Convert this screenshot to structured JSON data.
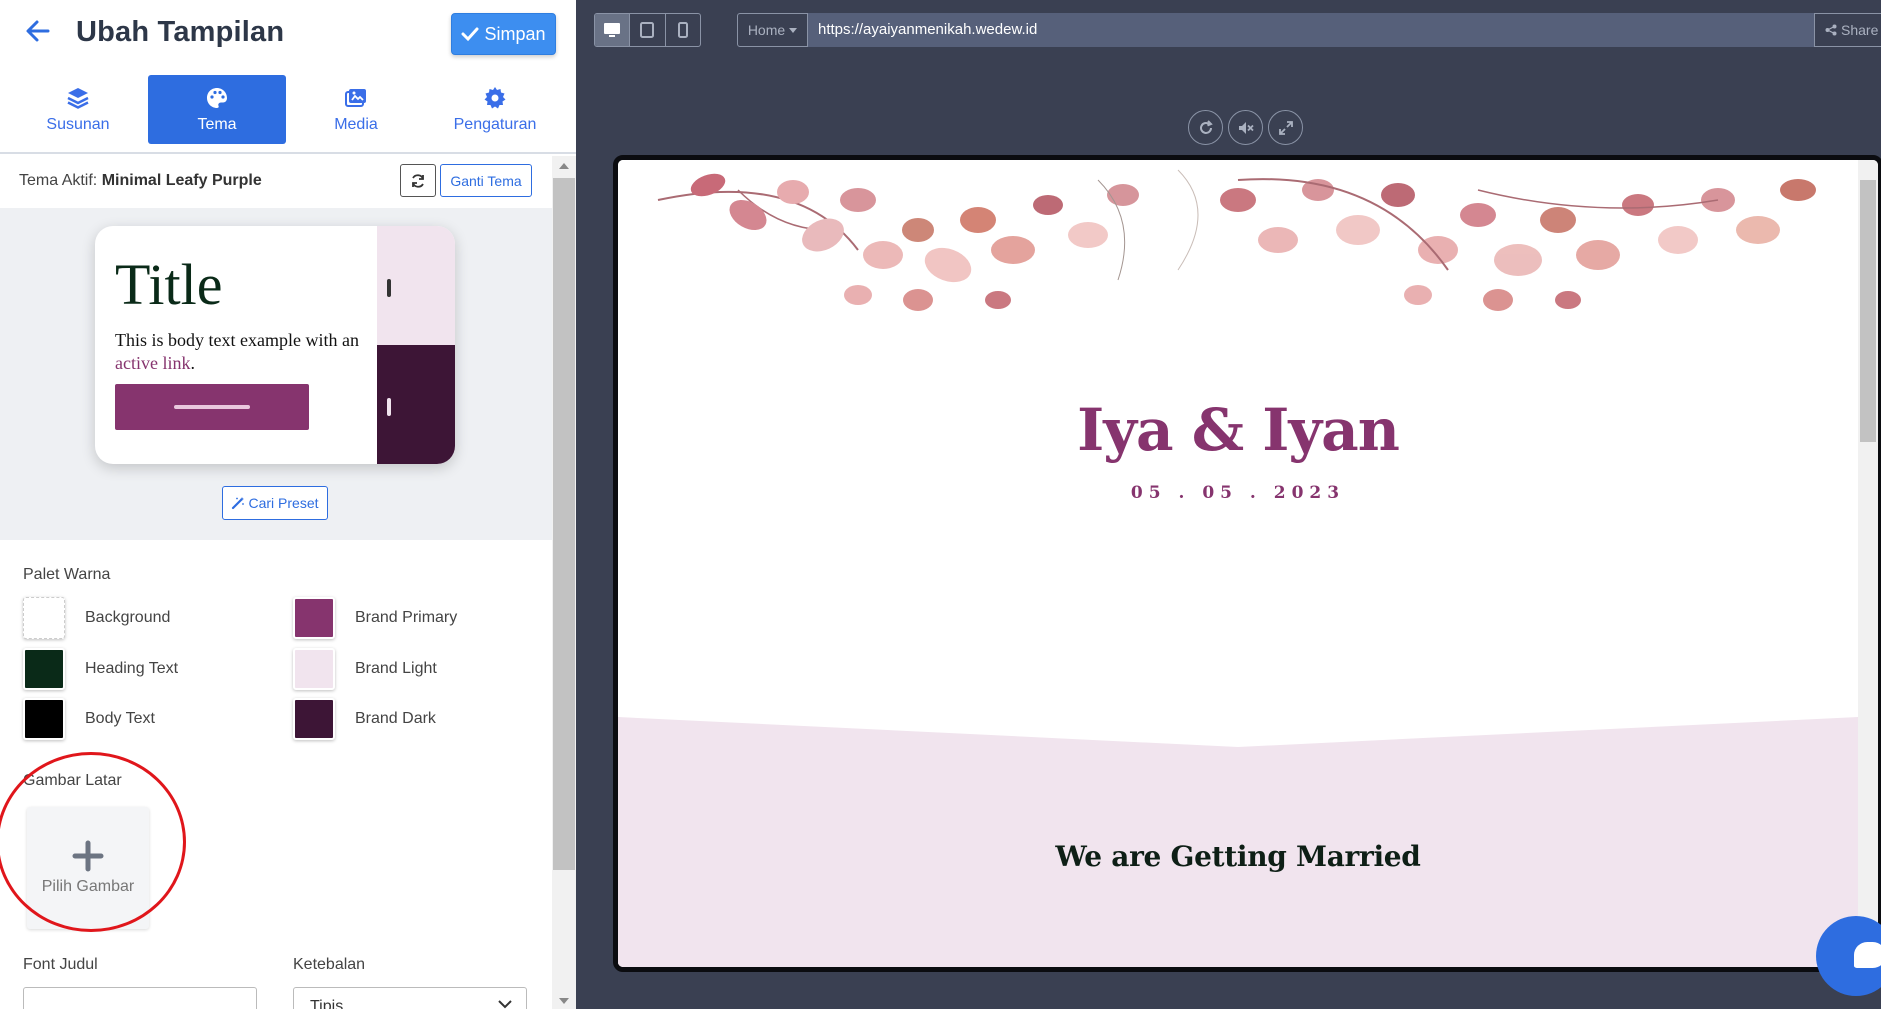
{
  "panel": {
    "title": "Ubah Tampilan",
    "save_label": "Simpan",
    "tabs": [
      {
        "label": "Susunan",
        "icon": "layers-icon"
      },
      {
        "label": "Tema",
        "icon": "palette-icon"
      },
      {
        "label": "Media",
        "icon": "images-icon"
      },
      {
        "label": "Pengaturan",
        "icon": "gear-icon"
      }
    ],
    "active_tab": "Tema",
    "active_theme_label": "Tema Aktif:",
    "active_theme_name": "Minimal Leafy Purple",
    "change_theme_label": "Ganti Tema",
    "preview": {
      "title": "Title",
      "body_prefix": "This is body text example with an ",
      "body_link": "active link",
      "body_suffix": "."
    },
    "find_preset_label": "Cari Preset",
    "palette_title": "Palet Warna",
    "palette": [
      {
        "label": "Background",
        "color": "#ffffff"
      },
      {
        "label": "Brand Primary",
        "color": "#86346e"
      },
      {
        "label": "Heading Text",
        "color": "#0a2a18"
      },
      {
        "label": "Brand Light",
        "color": "#f1e4ee"
      },
      {
        "label": "Body Text",
        "color": "#000000"
      },
      {
        "label": "Brand Dark",
        "color": "#3d1536"
      }
    ],
    "bg_image_title": "Gambar Latar",
    "pick_image_label": "Pilih Gambar",
    "font_title_label": "Font Judul",
    "weight_label": "Ketebalan",
    "weight_value": "Tipis"
  },
  "browser": {
    "home_label": "Home",
    "url": "https://ayaiyanmenikah.wedew.id",
    "share_label": "Share"
  },
  "site": {
    "couple": "Iya & Iyan",
    "date": "05 . 05 . 2023",
    "married": "We are Getting Married"
  },
  "colors": {
    "accent": "#2e6de0",
    "brand_primary": "#86346e",
    "highlight_circle": "#e0161b"
  }
}
